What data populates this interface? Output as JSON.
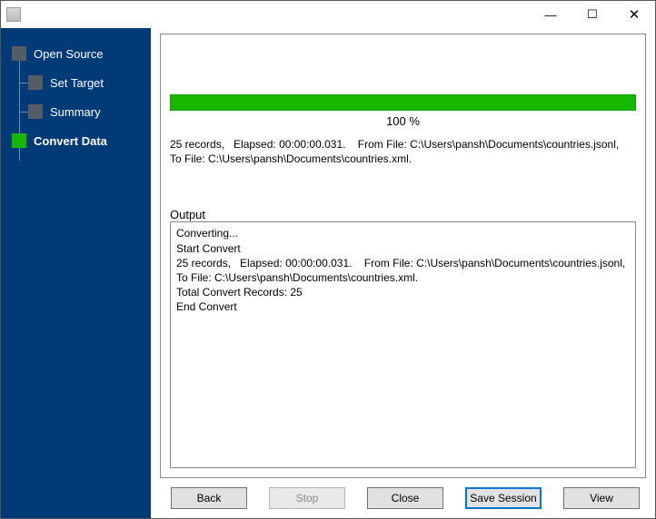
{
  "window": {
    "minimize": "—",
    "maximize": "☐",
    "close": "✕"
  },
  "sidebar": {
    "steps": [
      {
        "label": "Open Source",
        "active": false,
        "child": false
      },
      {
        "label": "Set Target",
        "active": false,
        "child": true
      },
      {
        "label": "Summary",
        "active": false,
        "child": true
      },
      {
        "label": "Convert Data",
        "active": true,
        "child": false
      }
    ]
  },
  "progress": {
    "percent_label": "100 %",
    "value": 100
  },
  "summary_text": "25 records,   Elapsed: 00:00:00.031.    From File: C:\\Users\\pansh\\Documents\\countries.jsonl,    To File: C:\\Users\\pansh\\Documents\\countries.xml.",
  "output": {
    "label": "Output",
    "text": "Converting...\nStart Convert\n25 records,   Elapsed: 00:00:00.031.    From File: C:\\Users\\pansh\\Documents\\countries.jsonl,    To File: C:\\Users\\pansh\\Documents\\countries.xml.\nTotal Convert Records: 25\nEnd Convert"
  },
  "buttons": {
    "back": "Back",
    "stop": "Stop",
    "close": "Close",
    "save_session": "Save Session",
    "view": "View"
  }
}
